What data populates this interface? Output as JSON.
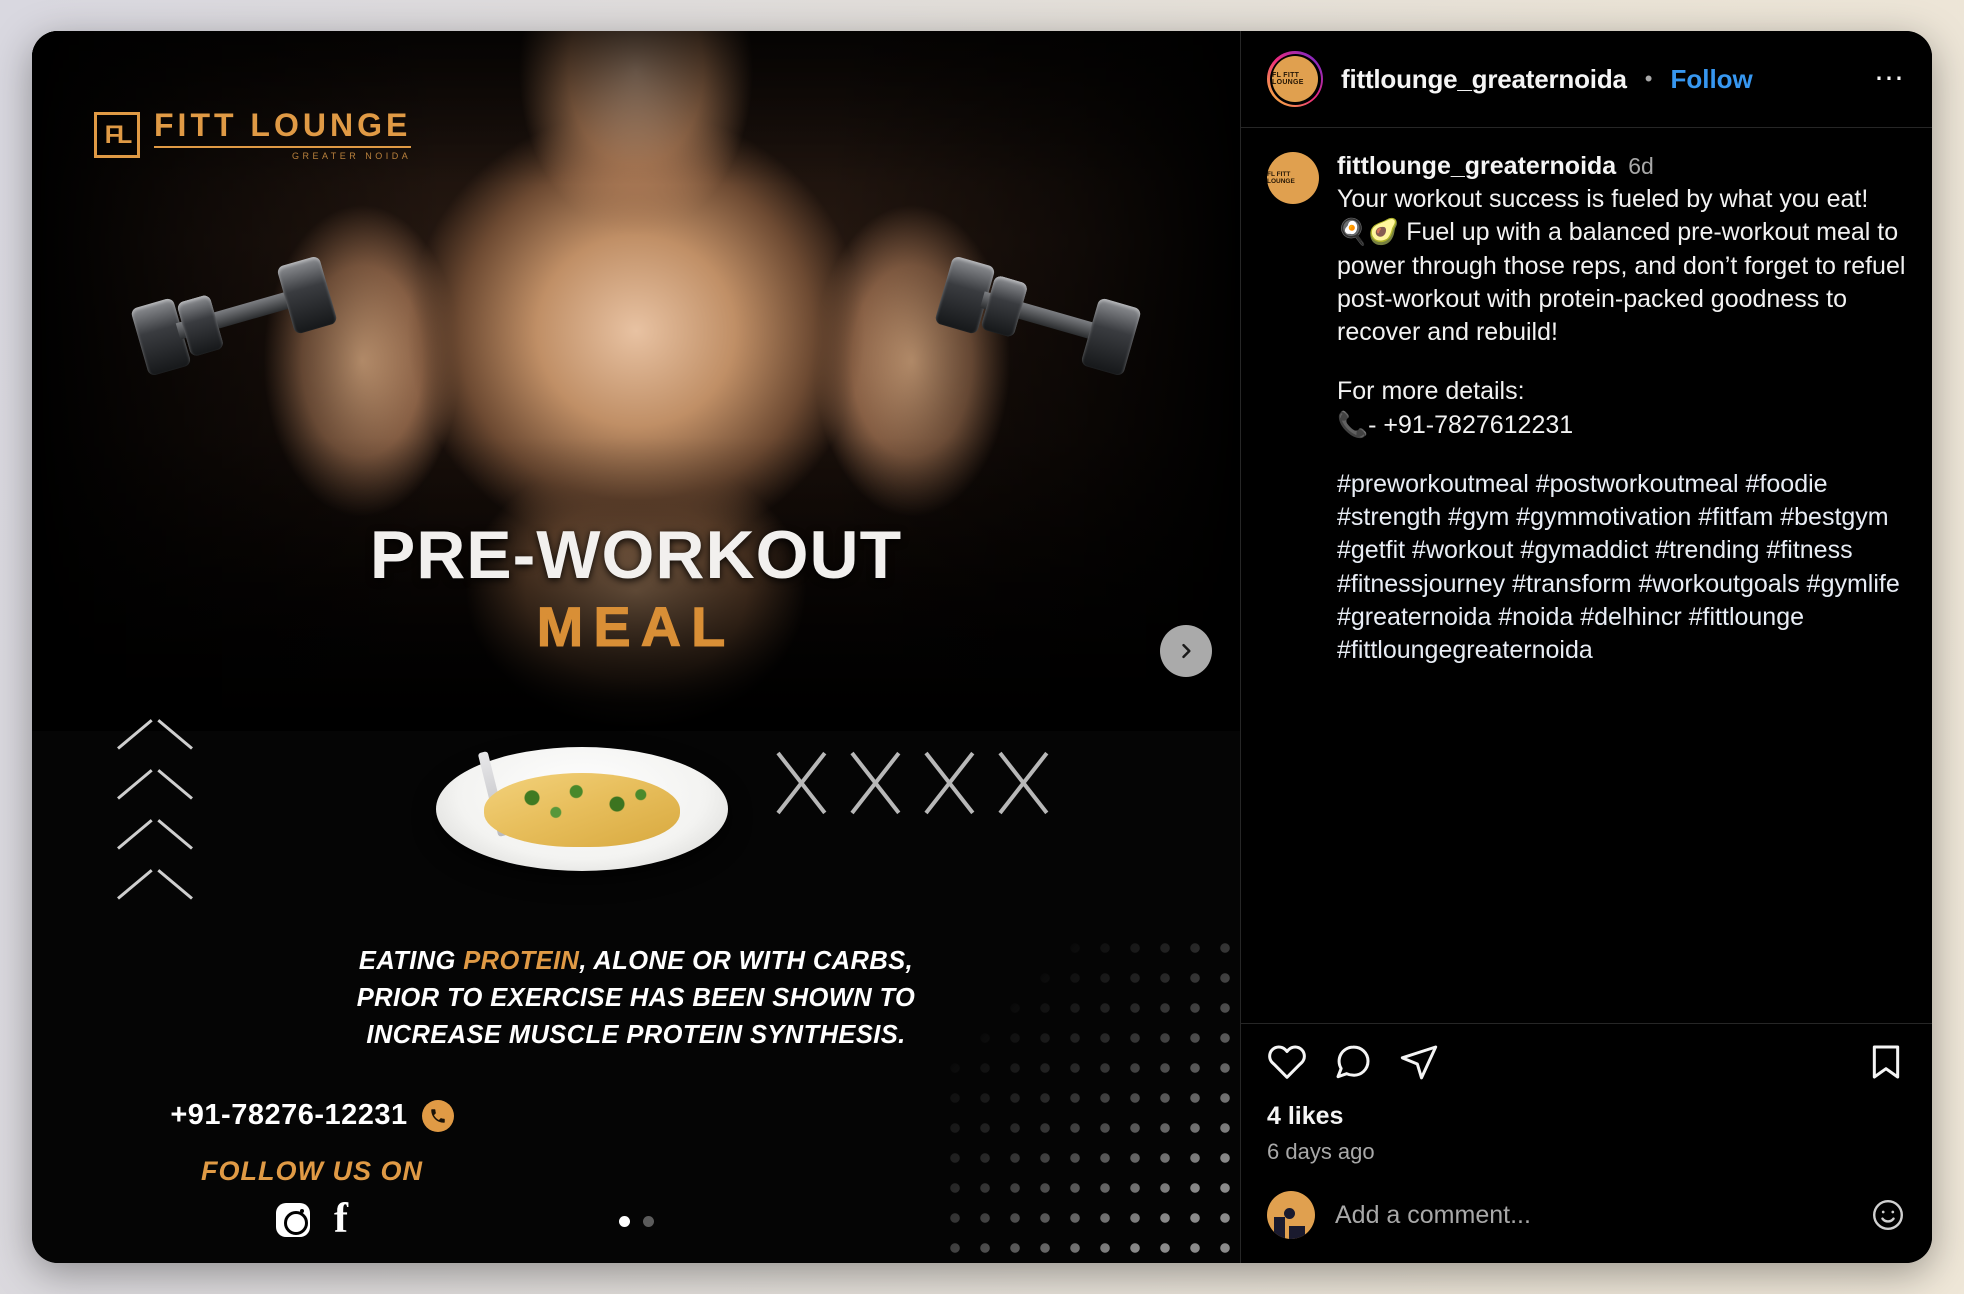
{
  "post": {
    "media": {
      "brand": {
        "mark": "FL",
        "name": "FITT LOUNGE",
        "sub": "GREATER NOIDA"
      },
      "headline_main": "PRE-WORKOUT",
      "headline_sub": "MEAL",
      "body_part1": "EATING ",
      "body_highlight": "PROTEIN",
      "body_part2": ", ALONE OR WITH CARBS,",
      "body_line2": "PRIOR TO EXERCISE HAS BEEN SHOWN TO",
      "body_line3": "INCREASE MUSCLE PROTEIN SYNTHESIS.",
      "phone": "+91-78276-12231",
      "follow_label": "FOLLOW US ON",
      "social": [
        "instagram-icon",
        "facebook-icon"
      ],
      "next_icon": "chevron-right-icon",
      "dots": [
        {
          "active": true
        },
        {
          "active": false
        }
      ]
    },
    "header": {
      "username": "fittlounge_greaternoida",
      "separator": "•",
      "follow_label": "Follow",
      "more_icon": "more-options-icon",
      "avatar_text": "FL FITT LOUNGE"
    },
    "caption": {
      "username": "fittlounge_greaternoida",
      "time": "6d",
      "text": "Your workout success is fueled by what you eat! 🍳🥑 Fuel up with a balanced pre-workout meal to power through those reps, and don’t forget to refuel post-workout with protein-packed goodness to recover and rebuild!",
      "details": "For more details:\n📞- +91-7827612231",
      "hashtags": "#preworkoutmeal #postworkoutmeal #foodie #strength #gym #gymmotivation #fitfam #bestgym #getfit #workout #gymaddict #trending #fitness #fitnessjourney #transform #workoutgoals #gymlife #greaternoida #noida #delhincr #fittlounge #fittloungegreaternoida"
    },
    "actions": {
      "like_icon": "heart-icon",
      "comment_icon": "comment-icon",
      "share_icon": "share-icon",
      "save_icon": "bookmark-icon",
      "likes": "4 likes",
      "timestamp": "6 days ago"
    },
    "comment_bar": {
      "placeholder": "Add a comment...",
      "emoji_icon": "emoji-icon"
    }
  }
}
